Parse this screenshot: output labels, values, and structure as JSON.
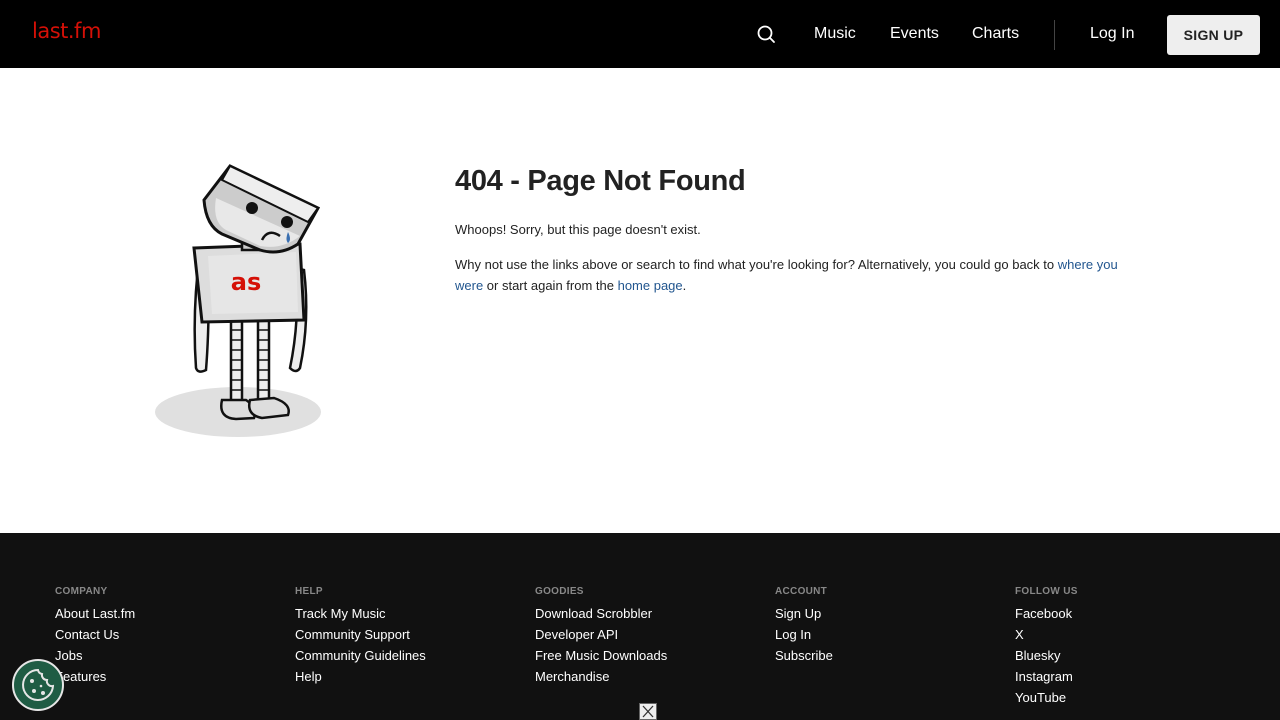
{
  "header": {
    "logo_text": "last.fm",
    "search_icon": "search-icon",
    "nav": [
      {
        "label": "Music"
      },
      {
        "label": "Events"
      },
      {
        "label": "Charts"
      }
    ],
    "login_label": "Log In",
    "signup_label": "SIGN UP"
  },
  "main": {
    "robot_logo_text": "as",
    "title": "404 - Page Not Found",
    "message1": "Whoops! Sorry, but this page doesn't exist.",
    "message2_part1": "Why not use the links above or search to find what you're looking for? Alternatively, you could go back to ",
    "message2_link1": "where you were",
    "message2_part2": " or start again from the ",
    "message2_link2": "home page",
    "message2_part3": "."
  },
  "footer": {
    "columns": [
      {
        "heading": "COMPANY",
        "links": [
          "About Last.fm",
          "Contact Us",
          "Jobs",
          "Features"
        ]
      },
      {
        "heading": "HELP",
        "links": [
          "Track My Music",
          "Community Support",
          "Community Guidelines",
          "Help"
        ]
      },
      {
        "heading": "GOODIES",
        "links": [
          "Download Scrobbler",
          "Developer API",
          "Free Music Downloads",
          "Merchandise"
        ]
      },
      {
        "heading": "ACCOUNT",
        "links": [
          "Sign Up",
          "Log In",
          "Subscribe"
        ]
      },
      {
        "heading": "FOLLOW US",
        "links": [
          "Facebook",
          "X",
          "Bluesky",
          "Instagram",
          "YouTube"
        ]
      }
    ]
  },
  "colors": {
    "brand_red": "#d51007",
    "header_bg": "#000000",
    "footer_bg": "#111111",
    "link_blue": "#22568f",
    "cookie_green": "#1f5c44"
  },
  "icons": {
    "cookie": "cookie-icon",
    "close": "close-icon"
  }
}
